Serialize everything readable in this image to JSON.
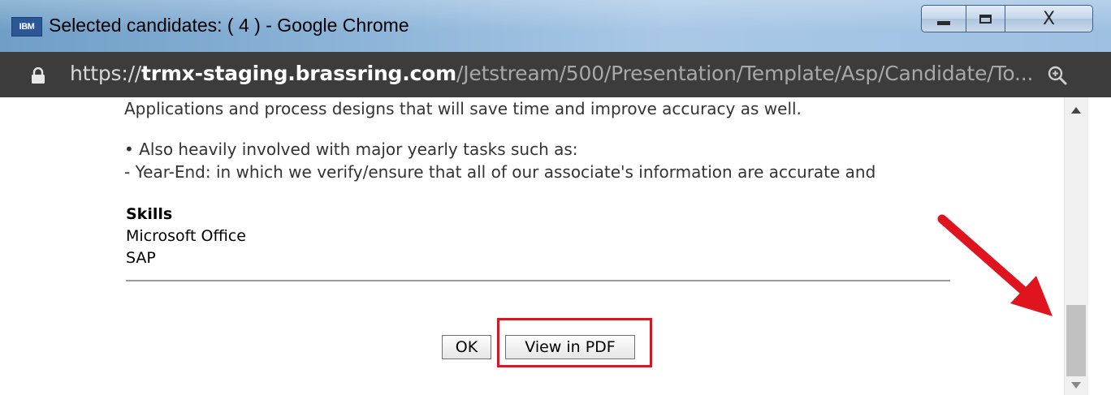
{
  "window": {
    "app_icon_label": "IBM",
    "title": "Selected candidates: ( 4 ) - Google Chrome",
    "controls": {
      "minimize_icon": "minimize-icon",
      "maximize_icon": "maximize-icon",
      "close_glyph": "X"
    }
  },
  "address_bar": {
    "lock_icon": "lock-icon",
    "url_scheme": "https://",
    "url_host": "trmx-staging.brassring.com",
    "url_path": "/Jetstream/500/Presentation/Template/Asp/Candidate/To...",
    "zoom_icon": "zoom-icon"
  },
  "content": {
    "resume_lines": [
      "Applications and process designs that will save time and improve accuracy as well.",
      "• Also heavily involved with major yearly tasks such as:",
      "- Year-End: in which we verify/ensure that all of our associate's information are accurate and"
    ],
    "skills": {
      "heading": "Skills",
      "items": [
        "Microsoft Office",
        "SAP"
      ]
    },
    "buttons": {
      "ok_label": "OK",
      "view_pdf_label": "View in PDF"
    }
  },
  "colors": {
    "highlight": "#e0141e",
    "address_bar_bg": "#3c3c3c"
  }
}
